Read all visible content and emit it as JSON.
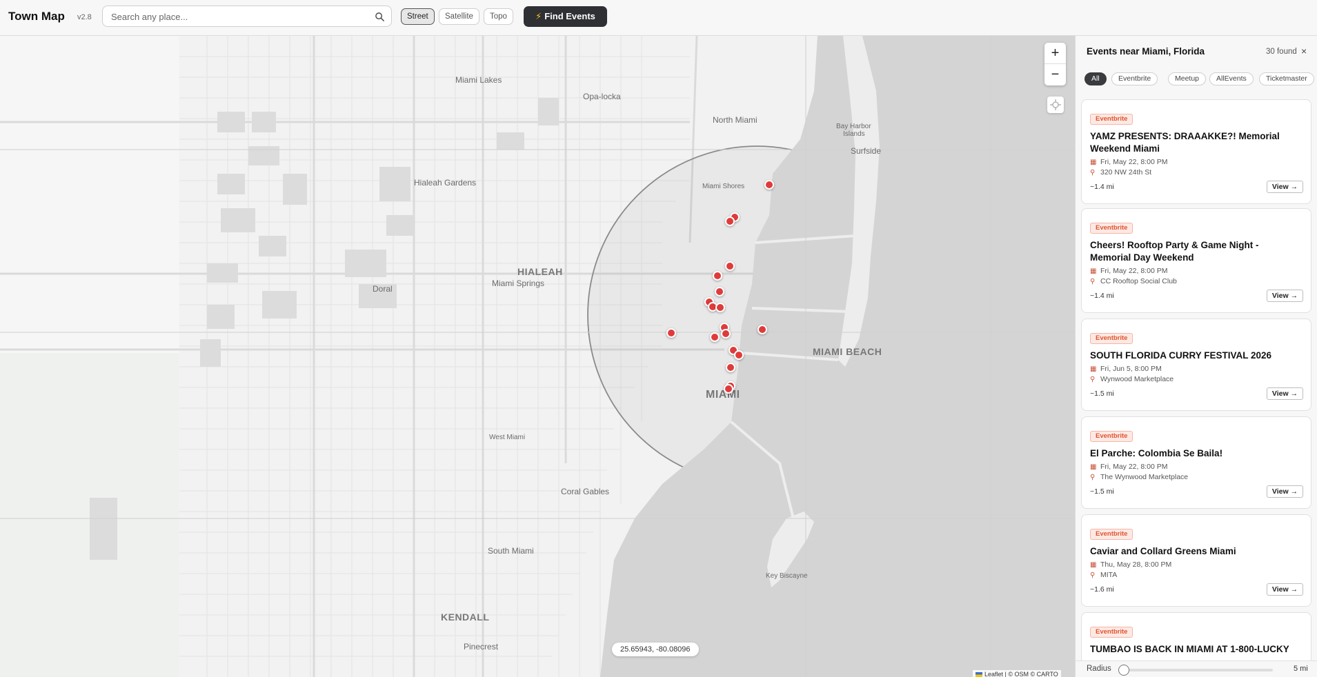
{
  "app": {
    "title": "Town Map",
    "version": "v2.8"
  },
  "search": {
    "placeholder": "Search any place..."
  },
  "map_styles": [
    "Street",
    "Satellite",
    "Topo"
  ],
  "map_style_active": "Street",
  "find_events": {
    "icon": "lightning-icon",
    "label": "Find Events"
  },
  "map": {
    "places": {
      "miami_lakes": "Miami Lakes",
      "opa_locka": "Opa-locka",
      "north_miami": "North Miami",
      "bay_harbor_1": "Bay Harbor",
      "bay_harbor_2": "Islands",
      "surfside": "Surfside",
      "hialeah_gardens": "Hialeah Gardens",
      "miami_shores": "Miami Shores",
      "hialeah": "HIALEAH",
      "miami_springs": "Miami Springs",
      "doral": "Doral",
      "miami_beach": "MIAMI BEACH",
      "miami": "MIAMI",
      "west_miami": "West Miami",
      "coral_gables": "Coral Gables",
      "south_miami": "South Miami",
      "key_biscayne": "Key Biscayne",
      "kendall": "KENDALL",
      "pinecrest": "Pinecrest"
    },
    "zoom_in": "+",
    "zoom_out": "−",
    "coords": "25.65943, -80.08096",
    "attribution": "Leaflet | © OSM © CARTO",
    "marker_color": "#e03b3b"
  },
  "sidebar": {
    "title": "Events near Miami, Florida",
    "count": "30 found",
    "close": "×",
    "filters": [
      "All",
      "Eventbrite",
      "Meetup",
      "AllEvents",
      "Ticketmaster"
    ],
    "filter_active": "All",
    "events": [
      {
        "source": "Eventbrite",
        "title": "YAMZ PRESENTS: DRAAAKKE?! Memorial Weekend Miami",
        "date": "Fri, May 22, 8:00 PM",
        "venue": "320 NW 24th St",
        "distance": "~1.4 mi",
        "action": "View →"
      },
      {
        "source": "Eventbrite",
        "title": "Cheers! Rooftop Party & Game Night - Memorial Day Weekend",
        "date": "Fri, May 22, 8:00 PM",
        "venue": "CC Rooftop Social Club",
        "distance": "~1.4 mi",
        "action": "View →"
      },
      {
        "source": "Eventbrite",
        "title": "SOUTH FLORIDA CURRY FESTIVAL 2026",
        "date": "Fri, Jun 5, 8:00 PM",
        "venue": "Wynwood Marketplace",
        "distance": "~1.5 mi",
        "action": "View →"
      },
      {
        "source": "Eventbrite",
        "title": "El Parche: Colombia Se Baila!",
        "date": "Fri, May 22, 8:00 PM",
        "venue": "The Wynwood Marketplace",
        "distance": "~1.5 mi",
        "action": "View →"
      },
      {
        "source": "Eventbrite",
        "title": "Caviar and Collard Greens Miami",
        "date": "Thu, May 28, 8:00 PM",
        "venue": "MITA",
        "distance": "~1.6 mi",
        "action": "View →"
      },
      {
        "source": "Eventbrite",
        "title": "TUMBAO IS BACK IN MIAMI AT 1-800-LUCKY",
        "date": "",
        "venue": "",
        "distance": "",
        "action": ""
      }
    ],
    "radius": {
      "label": "Radius",
      "value": "5 mi",
      "fraction": 0.0
    }
  }
}
